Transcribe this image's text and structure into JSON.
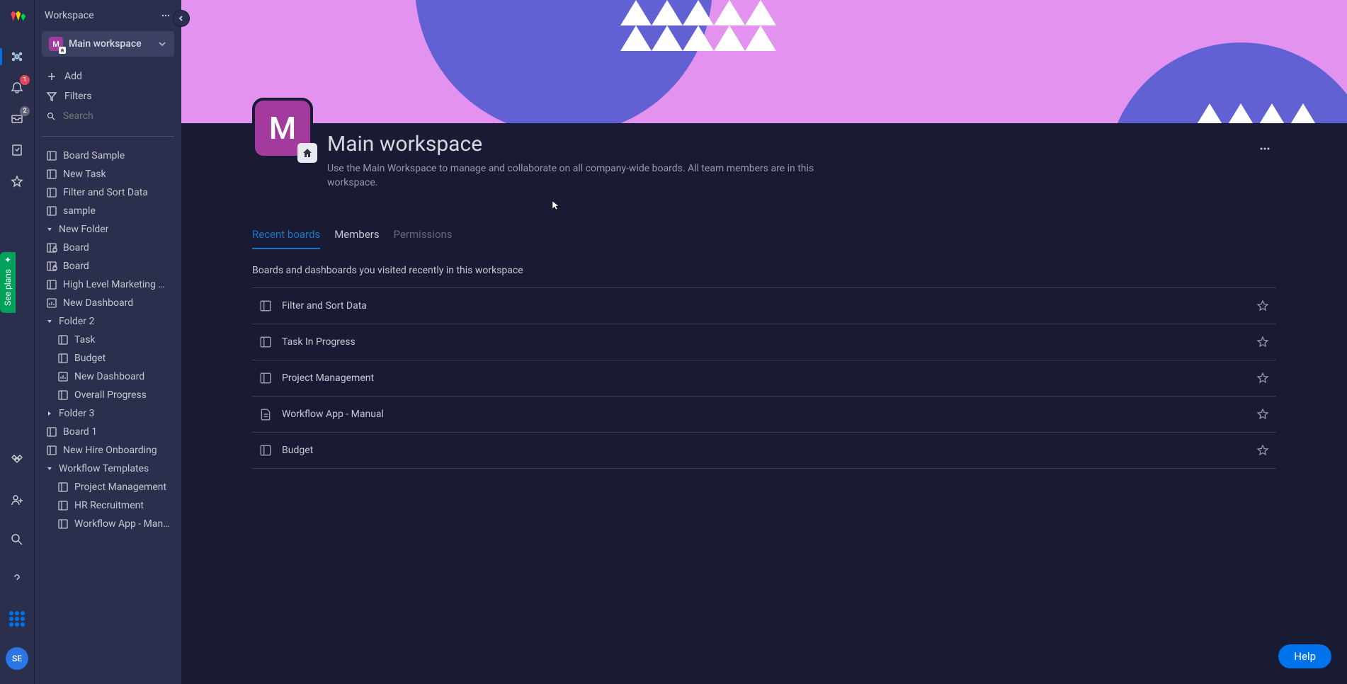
{
  "rail": {
    "notifications_count": "1",
    "inbox_count": "2",
    "avatar": "SE"
  },
  "see_plans": "See plans",
  "sidebar": {
    "header": "Workspace",
    "workspace_badge": "M",
    "workspace_name": "Main workspace",
    "add_label": "Add",
    "filters_label": "Filters",
    "search_placeholder": "Search",
    "items": [
      {
        "type": "board",
        "label": "Board Sample",
        "indent": 0
      },
      {
        "type": "board",
        "label": "New Task",
        "indent": 0
      },
      {
        "type": "board",
        "label": "Filter and Sort Data",
        "indent": 0
      },
      {
        "type": "board",
        "label": "sample",
        "indent": 0
      },
      {
        "type": "folder-open",
        "label": "New Folder",
        "indent": 0
      },
      {
        "type": "board-lock",
        "label": "Board",
        "indent": 0
      },
      {
        "type": "board-lock",
        "label": "Board",
        "indent": 0
      },
      {
        "type": "board",
        "label": "High Level Marketing Budg...",
        "indent": 0
      },
      {
        "type": "dashboard",
        "label": "New Dashboard",
        "indent": 0
      },
      {
        "type": "folder-open",
        "label": "Folder 2",
        "indent": 0
      },
      {
        "type": "board",
        "label": "Task",
        "indent": 1
      },
      {
        "type": "board",
        "label": "Budget",
        "indent": 1
      },
      {
        "type": "dashboard",
        "label": "New Dashboard",
        "indent": 1
      },
      {
        "type": "board",
        "label": "Overall Progress",
        "indent": 1
      },
      {
        "type": "folder-closed",
        "label": "Folder 3",
        "indent": 0
      },
      {
        "type": "board",
        "label": "Board 1",
        "indent": 0
      },
      {
        "type": "board",
        "label": "New Hire Onboarding",
        "indent": 0
      },
      {
        "type": "folder-open",
        "label": "Workflow Templates",
        "indent": 0
      },
      {
        "type": "board",
        "label": "Project Management",
        "indent": 1
      },
      {
        "type": "board",
        "label": "HR Recruitment",
        "indent": 1
      },
      {
        "type": "board",
        "label": "Workflow App - Manual",
        "indent": 1
      }
    ]
  },
  "main": {
    "badge": "M",
    "title": "Main workspace",
    "description": "Use the Main Workspace to manage and collaborate on all company-wide boards. All team members are in this workspace.",
    "tabs": [
      "Recent boards",
      "Members",
      "Permissions"
    ],
    "list_description": "Boards and dashboards you visited recently in this workspace",
    "boards": [
      {
        "type": "board",
        "name": "Filter and Sort Data"
      },
      {
        "type": "board",
        "name": "Task In Progress"
      },
      {
        "type": "board",
        "name": "Project Management"
      },
      {
        "type": "doc",
        "name": "Workflow App - Manual"
      },
      {
        "type": "board",
        "name": "Budget"
      }
    ]
  },
  "help": "Help"
}
